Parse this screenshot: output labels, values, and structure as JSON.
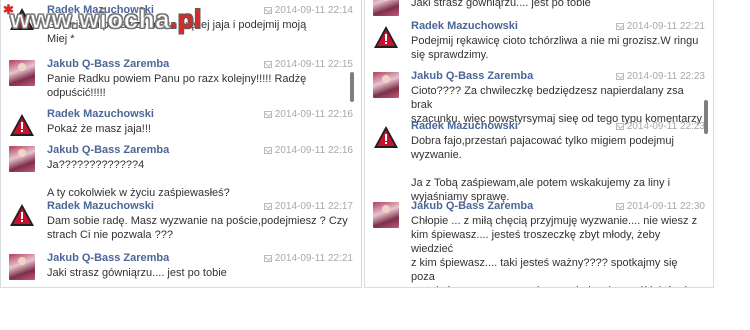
{
  "watermark": {
    "main": "www.wiocha",
    "tld": ".pl"
  },
  "left": {
    "messages": [
      {
        "avatar": "warning-icon",
        "sender": "Radek Mazuchowski",
        "time": "2014-09-11 22:14",
        "text": "Gówniarzu pokaż że masz więcej jaja i podejmij moją\nMiej *"
      },
      {
        "avatar": "profile-photo",
        "sender": "Jakub Q-Bass Zaremba",
        "time": "2014-09-11 22:15",
        "text": "Panie Radku powiem Panu po razx kolejny!!!!! Radżę\nodpuścić!!!!!"
      },
      {
        "avatar": "warning-icon",
        "sender": "Radek Mazuchowski",
        "time": "2014-09-11 22:16",
        "text": "Pokaż że masz jaja!!!"
      },
      {
        "avatar": "profile-photo",
        "sender": "Jakub Q-Bass Zaremba",
        "time": "2014-09-11 22:16",
        "text": "Ja?????????????4\n\nA ty cokolwiek w życiu zaśpiewasłeś?"
      },
      {
        "avatar": "warning-icon",
        "sender": "Radek Mazuchowski",
        "time": "2014-09-11 22:17",
        "text": "Dam sobie radę. Masz wyzwanie na poście,podejmiesz ? Czy\nstrach Ci nie pozwala ???"
      },
      {
        "avatar": "profile-photo",
        "sender": "Jakub Q-Bass Zaremba",
        "time": "2014-09-11 22:21",
        "text": "Jaki strasz gówniąrzu.... jest po tobie"
      }
    ]
  },
  "right": {
    "top_text": "Jaki strasz gówniąrzu.... jest po tobie",
    "messages": [
      {
        "avatar": "warning-icon",
        "sender": "Radek Mazuchowski",
        "time": "2014-09-11 22:21",
        "text": "Podejmij rękawicę cioto tchórzliwa a nie mi grozisz.W ringu\nsię sprawdzimy."
      },
      {
        "avatar": "profile-photo",
        "sender": "Jakub Q-Bass Zaremba",
        "time": "2014-09-11 22:23",
        "text": "Cioto???? Za chwileczkę bedziędzesz napierdalany zsa brak\nszacunku, więc powstyrsymaj sieę od tego typu komentarzy"
      },
      {
        "avatar": "warning-icon",
        "sender": "Radek Mazuchowski",
        "time": "2014-09-11 22:23",
        "text": "Dobra fajo,przestań pajacować tylko migiem podejmuj\nwyzwanie.\n\nJa z Tobą zaśpiewam,ale potem wskakujemy za liny i\nwyjaśniamy sprawę."
      },
      {
        "avatar": "profile-photo",
        "sender": "Jakub Q-Bass Zaremba",
        "time": "2014-09-11 22:30",
        "text": "Chłopie ... z miłą chęcią przyjmuję wyzwanie.... nie wiesz z\nkim śpiewasz.... jesteś troszeczkę zbyt młody, żeby wiedzieć\nz kim śpiewasz.... taki jesteś ważny???? spotkajmy się poza\nprotokołem.... wyzywam cię na pojedynek..... póki, ktòryś nie\npadnie.... 3 liny... i nie ma zmiłuj... ja się kurwa nie bję....."
      }
    ]
  }
}
